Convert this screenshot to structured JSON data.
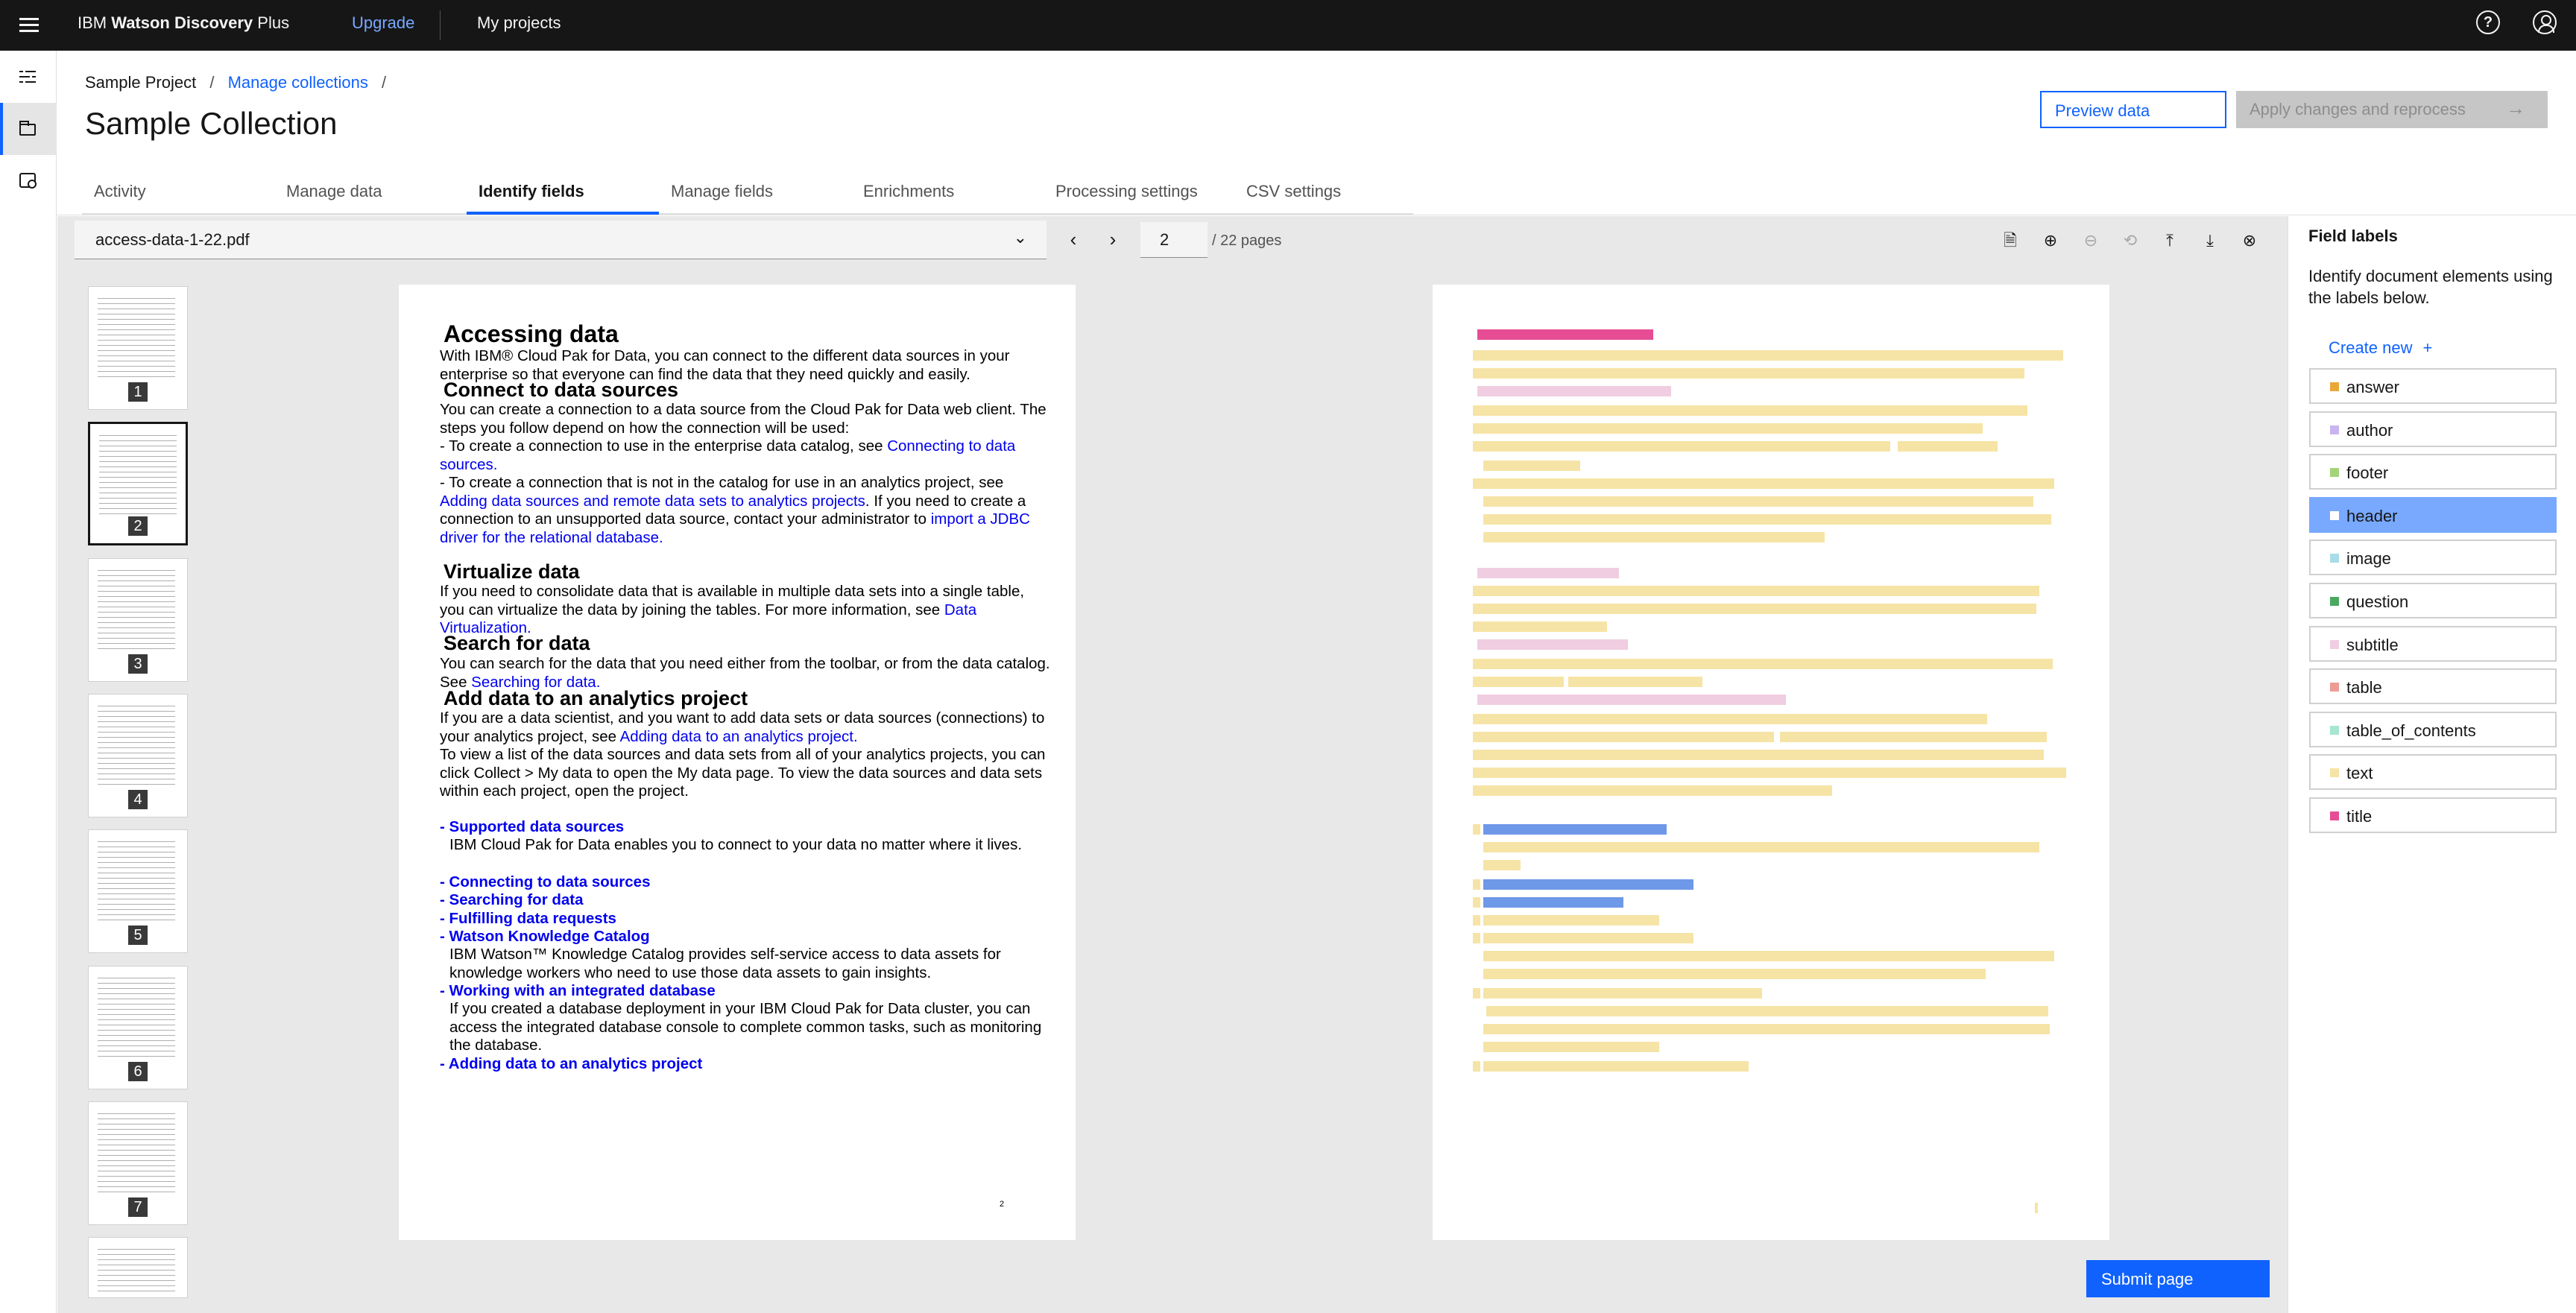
{
  "app": {
    "brand_prefix": "IBM",
    "brand_bold": "Watson Discovery",
    "brand_suffix": "Plus",
    "upgrade": "Upgrade",
    "my_projects": "My projects",
    "help_icon": "?"
  },
  "breadcrumb": {
    "project": "Sample Project",
    "sep": "/",
    "collections": "Manage collections"
  },
  "title": "Sample Collection",
  "buttons": {
    "preview": "Preview data",
    "apply": "Apply changes and reprocess",
    "apply_arrow": "→",
    "submit": "Submit page"
  },
  "tabs": [
    "Activity",
    "Manage data",
    "Identify fields",
    "Manage fields",
    "Enrichments",
    "Processing settings",
    "CSV settings"
  ],
  "active_tab": "Identify fields",
  "viewer": {
    "file_name": "access-data-1-22.pdf",
    "current_page": "2",
    "total_pages": "/ 22 pages",
    "thumbnails": [
      "1",
      "2",
      "3",
      "4",
      "5",
      "6",
      "7"
    ],
    "selected_thumbnail": "2",
    "tools": [
      "file-icon",
      "zoom-in-icon",
      "zoom-out-icon",
      "zoom-reset-icon",
      "upload-icon",
      "download-icon",
      "close-circle-icon"
    ]
  },
  "document": {
    "h_accessing": "Accessing data",
    "p1": "With IBM® Cloud Pak for Data, you can connect to the different data sources in your enterprise so that everyone can find the data that they need quickly and easily.",
    "h_connect": "Connect to data sources",
    "p2": "You can create a connection to a data source from the Cloud Pak for Data web client.  The steps you follow depend on how the connection will be used:",
    "p3a": "- To create a connection to use in the enterprise data catalog, see ",
    "p3link": "Connecting to data sources.",
    "p4a": "- To create a connection that is not in the catalog for use in an analytics project, see ",
    "p4link": "Adding data sources and remote data sets to analytics projects",
    "p4b": ". If you need to create a connection to an unsupported data source, contact your administrator to ",
    "p4link2": "import a JDBC driver for the relational database.",
    "h_virtualize": "Virtualize data",
    "p5": "If you need to consolidate data that is available in multiple data sets into a single table, you can virtualize the data by joining the tables. For more information, see ",
    "p5link": "Data Virtualization.",
    "h_search": "Search for data",
    "p6": "You can search for the data that you need either from the toolbar, or from the data catalog. See ",
    "p6link": "Searching for data.",
    "h_add": "Add data to an analytics project",
    "p7": "If you are a data scientist, and you want to add data sets or data sources (connections) to your analytics project, see ",
    "p7link": "Adding data to an analytics project.",
    "p8": "To view a list of the data sources and data sets from all of your analytics projects, you can click Collect > My data to open the My data page.  To view the data sources and data sets within each project, open the project.",
    "l1": "Supported data sources",
    "l1d": "IBM Cloud Pak for Data enables you to connect to your data no matter where it lives.",
    "l2": "Connecting to data sources",
    "l3": "Searching for data",
    "l4": "Fulfilling data requests",
    "l5": "Watson Knowledge Catalog",
    "l5d": "IBM Watson™ Knowledge Catalog provides self-service access to data assets for knowledge workers who need to use those data assets to gain insights.",
    "l6": "Working with an integrated database",
    "l6d": " If you created a database deployment in your IBM Cloud Pak for Data cluster, you can access the integrated database console to complete common tasks, such as monitoring the database.",
    "l7": "Adding data to an analytics project",
    "dash": "- ",
    "page_number": "2"
  },
  "field_labels": {
    "title": "Field labels",
    "description": "Identify document elements using the labels below.",
    "create_new": "Create new",
    "plus": "+",
    "active": "header",
    "items": [
      {
        "name": "answer",
        "color": "#e8a838"
      },
      {
        "name": "author",
        "color": "#c8b4ef"
      },
      {
        "name": "footer",
        "color": "#a4d47a"
      },
      {
        "name": "header",
        "color": "#ffffff"
      },
      {
        "name": "image",
        "color": "#a7dde6"
      },
      {
        "name": "question",
        "color": "#4aa860"
      },
      {
        "name": "subtitle",
        "color": "#f0cde0"
      },
      {
        "name": "table",
        "color": "#ec9c94"
      },
      {
        "name": "table_of_contents",
        "color": "#a6e6d2"
      },
      {
        "name": "text",
        "color": "#f6e4a6"
      },
      {
        "name": "title",
        "color": "#e74d94"
      }
    ]
  }
}
